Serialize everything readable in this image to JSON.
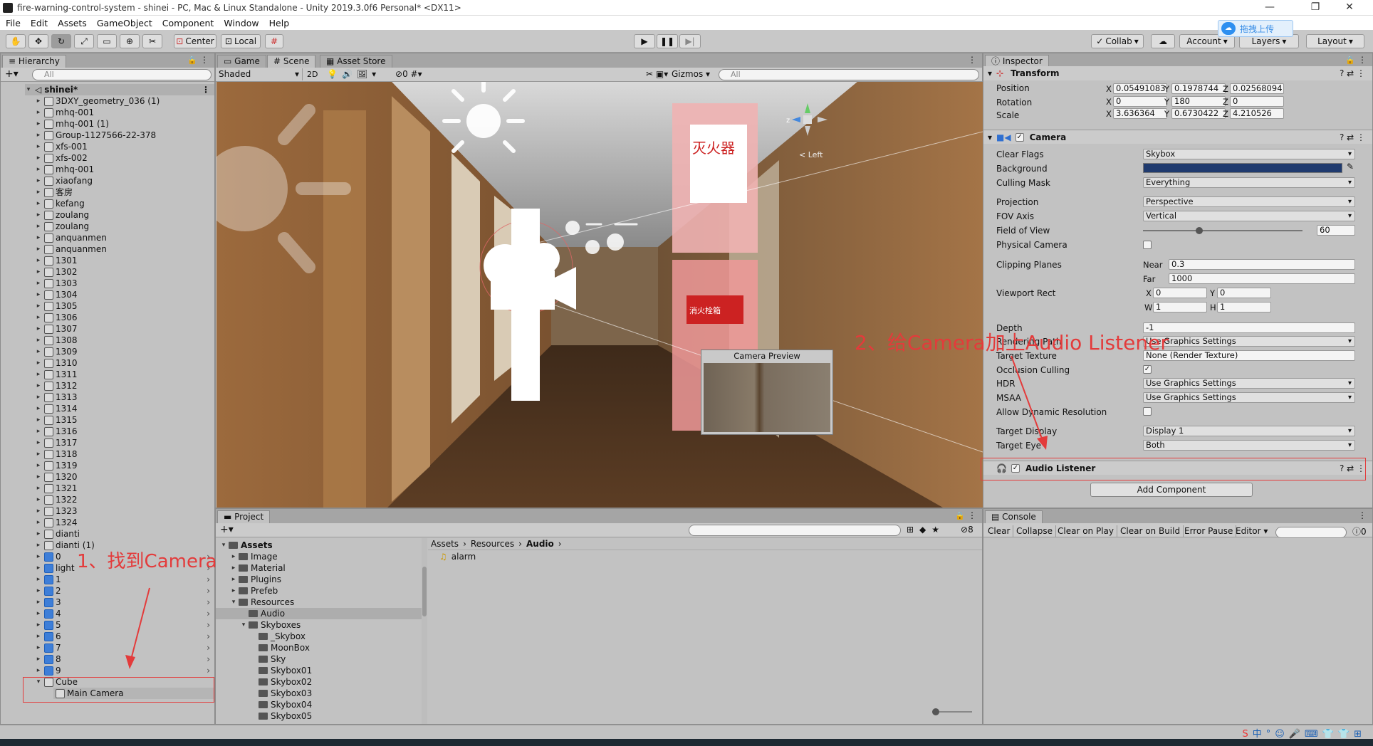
{
  "window": {
    "title": "fire-warning-control-system - shinei - PC, Mac & Linux Standalone - Unity 2019.3.0f6 Personal* <DX11>",
    "upload_label": "拖拽上传"
  },
  "menu": [
    "File",
    "Edit",
    "Assets",
    "GameObject",
    "Component",
    "Window",
    "Help"
  ],
  "toolbar": {
    "center_label": "Center",
    "local_label": "Local",
    "collab_label": "Collab",
    "account_label": "Account",
    "layers_label": "Layers",
    "layout_label": "Layout"
  },
  "hierarchy": {
    "tab": "Hierarchy",
    "search_placeholder": "All",
    "scene_name": "shinei*",
    "items": [
      "3DXY_geometry_036 (1)",
      "mhq-001",
      "mhq-001 (1)",
      "Group-1127566-22-378",
      "xfs-001",
      "xfs-002",
      "mhq-001",
      "xiaofang",
      "客房",
      "kefang",
      "zoulang",
      "zoulang",
      "anquanmen",
      "anquanmen",
      "1301",
      "1302",
      "1303",
      "1304",
      "1305",
      "1306",
      "1307",
      "1308",
      "1309",
      "1310",
      "1311",
      "1312",
      "1313",
      "1314",
      "1315",
      "1316",
      "1317",
      "1318",
      "1319",
      "1320",
      "1321",
      "1322",
      "1323",
      "1324",
      "dianti",
      "dianti (1)"
    ],
    "prefab_items": [
      "0",
      "light",
      "1",
      "2",
      "3",
      "4",
      "5",
      "6",
      "7",
      "8",
      "9"
    ],
    "cube_label": "Cube",
    "main_camera_label": "Main Camera"
  },
  "scene": {
    "tabs": [
      "Game",
      "Scene",
      "Asset Store"
    ],
    "shading": "Shaded",
    "mode_2d": "2D",
    "hidden_count": "0",
    "gizmos_label": "Gizmos",
    "search_placeholder": "All",
    "axis_label": "< Left",
    "camera_preview_title": "Camera Preview",
    "sign_text_1": "灭火器",
    "sign_text_2": "消火栓箱"
  },
  "inspector": {
    "tab": "Inspector",
    "transform": {
      "title": "Transform",
      "position": {
        "label": "Position",
        "x": "0.05491083",
        "y": "0.1978744",
        "z": "0.02568094"
      },
      "rotation": {
        "label": "Rotation",
        "x": "0",
        "y": "180",
        "z": "0"
      },
      "scale": {
        "label": "Scale",
        "x": "3.636364",
        "y": "0.6730422",
        "z": "4.210526"
      }
    },
    "camera": {
      "title": "Camera",
      "clear_flags_label": "Clear Flags",
      "clear_flags": "Skybox",
      "background_label": "Background",
      "background_color": "#1f3a6e",
      "culling_mask_label": "Culling Mask",
      "culling_mask": "Everything",
      "projection_label": "Projection",
      "projection": "Perspective",
      "fov_axis_label": "FOV Axis",
      "fov_axis": "Vertical",
      "fov_label": "Field of View",
      "fov": "60",
      "fov_fraction": 0.33,
      "physical_camera_label": "Physical Camera",
      "clipping_label": "Clipping Planes",
      "near_label": "Near",
      "near": "0.3",
      "far_label": "Far",
      "far": "1000",
      "viewport_label": "Viewport Rect",
      "vx": "0",
      "vy": "0",
      "vw": "1",
      "vh": "1",
      "depth_label": "Depth",
      "depth": "-1",
      "rendering_path_label": "Rendering Path",
      "rendering_path": "Use Graphics Settings",
      "target_texture_label": "Target Texture",
      "target_texture": "None (Render Texture)",
      "occlusion_label": "Occlusion Culling",
      "hdr_label": "HDR",
      "hdr": "Use Graphics Settings",
      "msaa_label": "MSAA",
      "msaa": "Use Graphics Settings",
      "dynres_label": "Allow Dynamic Resolution",
      "target_display_label": "Target Display",
      "target_display": "Display 1",
      "target_eye_label": "Target Eye",
      "target_eye": "Both"
    },
    "audio_listener": "Audio Listener",
    "add_component": "Add Component"
  },
  "project": {
    "tab": "Project",
    "tree": [
      {
        "label": "Assets",
        "depth": 0,
        "open": true,
        "bold": true
      },
      {
        "label": "Image",
        "depth": 1
      },
      {
        "label": "Material",
        "depth": 1
      },
      {
        "label": "Plugins",
        "depth": 1
      },
      {
        "label": "Prefeb",
        "depth": 1
      },
      {
        "label": "Resources",
        "depth": 1,
        "open": true
      },
      {
        "label": "Audio",
        "depth": 2,
        "selected": true
      },
      {
        "label": "Skyboxes",
        "depth": 2,
        "open": true
      },
      {
        "label": "_Skybox",
        "depth": 3
      },
      {
        "label": "MoonBox",
        "depth": 3
      },
      {
        "label": "Sky",
        "depth": 3
      },
      {
        "label": "Skybox01",
        "depth": 3
      },
      {
        "label": "Skybox02",
        "depth": 3
      },
      {
        "label": "Skybox03",
        "depth": 3
      },
      {
        "label": "Skybox04",
        "depth": 3
      },
      {
        "label": "Skybox05",
        "depth": 3
      }
    ],
    "breadcrumb": [
      "Assets",
      "Resources",
      "Audio"
    ],
    "files": [
      "alarm"
    ],
    "hidden_count": "8"
  },
  "console": {
    "tab": "Console",
    "buttons": [
      "Clear",
      "Collapse",
      "Clear on Play",
      "Clear on Build",
      "Error Pause",
      "Editor"
    ],
    "error_count": "0"
  },
  "annotations": {
    "step1": "1、找到Camera",
    "step2": "2、给Camera加上Audio Listener"
  }
}
